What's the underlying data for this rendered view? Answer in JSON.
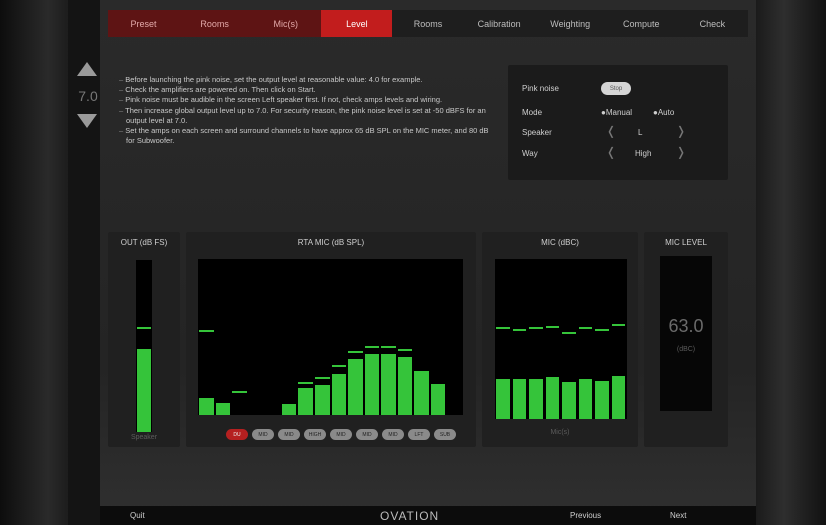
{
  "tabs": [
    {
      "label": "Preset",
      "style": "red"
    },
    {
      "label": "Rooms",
      "style": "red"
    },
    {
      "label": "Mic(s)",
      "style": "red"
    },
    {
      "label": "Level",
      "style": "active"
    },
    {
      "label": "Rooms",
      "style": "normal"
    },
    {
      "label": "Calibration",
      "style": "normal"
    },
    {
      "label": "Weighting",
      "style": "normal"
    },
    {
      "label": "Compute",
      "style": "normal"
    },
    {
      "label": "Check",
      "style": "normal"
    }
  ],
  "level": {
    "value": "7.0"
  },
  "instructions": [
    "Before launching the pink noise, set the output level at reasonable value: 4.0 for example.",
    "Check the amplifiers are powered on. Then click on Start.",
    "Pink noise must be audible in the screen Left speaker first. If not, check amps levels and wiring.",
    "Then increase global output level up to 7.0. For security reason, the pink noise level is set at -50 dBFS for an output level at 7.0.",
    "Set the amps on each screen and surround channels to have approx 65 dB SPL on the MIC meter, and 80 dB for Subwoofer."
  ],
  "settings": {
    "pink_label": "Pink noise",
    "pink_toggle": "Stop",
    "mode_label": "Mode",
    "mode_manual": "●Manual",
    "mode_auto": "●Auto",
    "speaker_label": "Speaker",
    "speaker_value": "L",
    "way_label": "Way",
    "way_value": "High"
  },
  "out_meter": {
    "title": "OUT (dB FS)",
    "footer": "Speaker",
    "level": 0.48,
    "peak": 0.6
  },
  "rta": {
    "title": "RTA MIC (dB SPL)",
    "bars": [
      0.11,
      0.08,
      0,
      0,
      0,
      0.07,
      0.17,
      0.19,
      0.26,
      0.36,
      0.39,
      0.39,
      0.37,
      0.28,
      0.2,
      0
    ],
    "peaks": [
      0.53,
      0,
      0.14,
      0,
      0,
      0,
      0.2,
      0.23,
      0.31,
      0.4,
      0.43,
      0.43,
      0.41,
      0,
      0,
      0
    ],
    "buttons": [
      "DU",
      "MID",
      "MID",
      "HIGH",
      "MID",
      "MID",
      "MID",
      "LFT",
      "SUB"
    ]
  },
  "mic": {
    "title": "MIC (dBC)",
    "footer": "Mic(s)",
    "bars": [
      0.25,
      0.25,
      0.25,
      0.26,
      0.23,
      0.25,
      0.24,
      0.27
    ],
    "peaks": [
      0.56,
      0.55,
      0.56,
      0.57,
      0.53,
      0.56,
      0.55,
      0.58
    ]
  },
  "mic_level": {
    "title": "MIC LEVEL",
    "value": "63.0",
    "unit": "(dBC)"
  },
  "bottom": {
    "quit": "Quit",
    "logo": "OVATION",
    "previous": "Previous",
    "next": "Next"
  },
  "colors": {
    "accent": "#c21d1d",
    "meter": "#35c43a"
  }
}
